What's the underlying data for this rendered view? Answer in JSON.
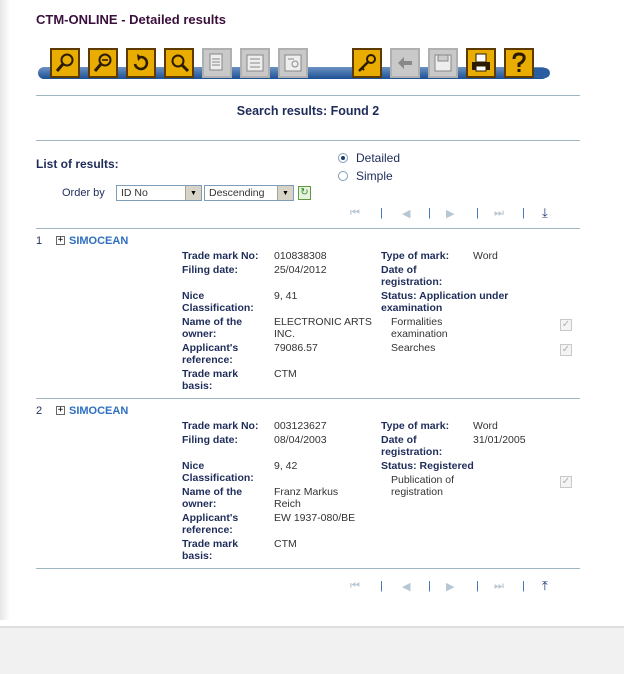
{
  "title": "CTM-ONLINE - Detailed results",
  "toolbar": {
    "buttons": [
      {
        "name": "simple-search-button",
        "icon": "magnifier-icon",
        "enabled": true
      },
      {
        "name": "advanced-search-button",
        "icon": "magnifier-plus-icon",
        "enabled": true
      },
      {
        "name": "back-search-button",
        "icon": "return-arrow-icon",
        "enabled": true
      },
      {
        "name": "search-by-key-button",
        "icon": "magnifier-key-icon",
        "enabled": true
      },
      {
        "name": "print-list-button",
        "icon": "document-icon",
        "enabled": false
      },
      {
        "name": "list-view-button",
        "icon": "list-icon",
        "enabled": false
      },
      {
        "name": "details-view-button",
        "icon": "detail-card-icon",
        "enabled": false
      },
      {
        "name": "login-button",
        "icon": "key-icon",
        "enabled": true
      },
      {
        "name": "back-button",
        "icon": "arrow-left-icon",
        "enabled": false
      },
      {
        "name": "save-button",
        "icon": "floppy-disk-icon",
        "enabled": false
      },
      {
        "name": "print-button",
        "icon": "printer-icon",
        "enabled": true
      },
      {
        "name": "help-button",
        "icon": "question-icon",
        "enabled": true
      }
    ]
  },
  "search": {
    "found_text": "Search results: Found 2"
  },
  "list": {
    "label": "List of results:",
    "view_options": [
      {
        "label": "Detailed",
        "selected": true
      },
      {
        "label": "Simple",
        "selected": false
      }
    ],
    "order_by_label": "Order by",
    "order_by_value": "ID No",
    "direction_value": "Descending"
  },
  "field_labels": {
    "trade_mark_no": "Trade mark No:",
    "filing_date": "Filing date:",
    "nice_1": "Nice",
    "nice_2": "Classification:",
    "owner_1": "Name of the",
    "owner_2": "owner:",
    "ref_1": "Applicant's",
    "ref_2": "reference:",
    "basis_1": "Trade mark",
    "basis_2": "basis:",
    "type": "Type of mark:",
    "date_reg_1": "Date of",
    "date_reg_2": "registration:",
    "status": "Status:"
  },
  "results": [
    {
      "index": "1",
      "name": "SIMOCEAN",
      "trade_mark_no": "010838308",
      "filing_date": "25/04/2012",
      "nice": "9, 41",
      "owner_1": "ELECTRONIC ARTS",
      "owner_2": "INC.",
      "reference": "79086.57",
      "basis": "CTM",
      "type": "Word",
      "date_registration": "",
      "status_1": "Application under",
      "status_2": "examination",
      "progress": [
        {
          "label_1": "Formalities",
          "label_2": "examination",
          "checked": true
        },
        {
          "label_1": "Searches",
          "label_2": "",
          "checked": true
        }
      ]
    },
    {
      "index": "2",
      "name": "SIMOCEAN",
      "trade_mark_no": "003123627",
      "filing_date": "08/04/2003",
      "nice": "9, 42",
      "owner_1": "Franz Markus",
      "owner_2": "Reich",
      "reference": "EW 1937-080/BE",
      "basis": "CTM",
      "type": "Word",
      "date_registration": "31/01/2005",
      "status_1": "Registered",
      "status_2": "",
      "progress": [
        {
          "label_1": "Publication of",
          "label_2": "registration",
          "checked": true
        }
      ]
    }
  ],
  "pager": {
    "first": "⏮",
    "prev": "◀",
    "next": "▶",
    "last": "⏭",
    "separator": "|",
    "to_bottom": "⤓",
    "to_top": "⤒"
  },
  "colors": {
    "title": "#3b0f3c",
    "toolbar_active": "#e9ac00",
    "toolbar_bar": "#1d4f95",
    "link": "#2d6fc1",
    "label": "#1e2c5a"
  }
}
